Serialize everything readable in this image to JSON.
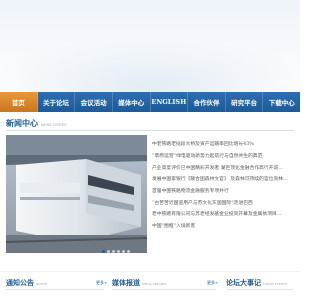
{
  "nav": {
    "items": [
      {
        "label": "首页",
        "active": true
      },
      {
        "label": "关于论坛",
        "active": false
      },
      {
        "label": "会议活动",
        "active": false
      },
      {
        "label": "媒体中心",
        "active": false
      },
      {
        "label": "ENGLISH",
        "active": false
      },
      {
        "label": "合作伙伴",
        "active": false
      },
      {
        "label": "研究平台",
        "active": false
      },
      {
        "label": "下载中心",
        "active": false
      }
    ]
  },
  "news_center": {
    "title": "新闻中心",
    "subtitle": "NEWS CENTER",
    "items": [
      "中老铁路老挝段大桥及资产运输率回比增长43%",
      "“草原运营”绿电驱动新势力起航行与自然共生的典范",
      "产业高度评价已中国精彩开发者 湖巨顶化金融合作高行开说…",
      "发展中国家银行《联合国森林文官》 及森林可持续的官位资林…",
      "首届中国铁路物流金融服务专项并行",
      "“古苦苦近国道用产与苏文化东国国际”走进巴西",
      "老中铁路有限公司与苏老经发基金业投资开幕及金属依项目…",
      "中国“圈框”入境新客"
    ]
  },
  "bottom": {
    "notice": {
      "title": "通知公告",
      "subtitle": "NOTICE",
      "more": "更多+"
    },
    "media": {
      "title": "媒体报道",
      "subtitle": "MEDIA REPORTS",
      "more": "更多+"
    },
    "events": {
      "title": "论坛大事记",
      "subtitle": "FORUM EVENTS"
    }
  },
  "colors": {
    "nav": "#1d5a98",
    "active": "#e89a3a",
    "accent": "#1d5a98"
  }
}
